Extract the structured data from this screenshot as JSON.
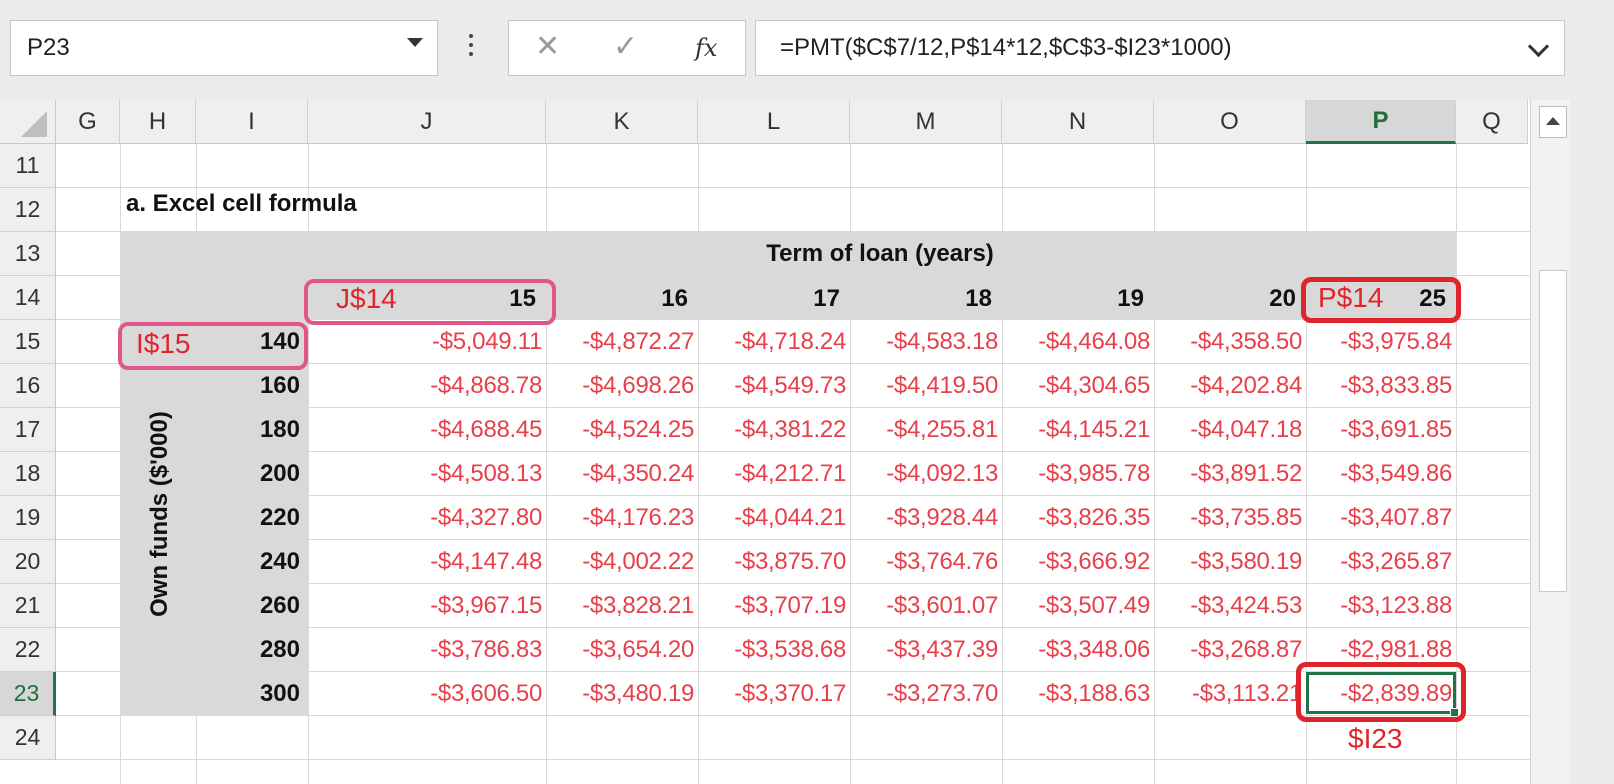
{
  "toolbar": {
    "name_box": "P23",
    "cancel_glyph": "✕",
    "enter_glyph": "✓",
    "fx_label": "fx",
    "formula": "=PMT($C$7/12,P$14*12,$C$3-$I23*1000)"
  },
  "columns": [
    "G",
    "H",
    "I",
    "J",
    "K",
    "L",
    "M",
    "N",
    "O",
    "P",
    "Q"
  ],
  "rows": [
    "11",
    "12",
    "13",
    "14",
    "15",
    "16",
    "17",
    "18",
    "19",
    "20",
    "21",
    "22",
    "23",
    "24"
  ],
  "sheet": {
    "title": "a. Excel cell formula",
    "term_header": "Term of loan (years)",
    "own_funds_label": "Own funds ($'000)",
    "years": [
      "15",
      "16",
      "17",
      "18",
      "19",
      "20",
      "25"
    ],
    "funds": [
      "140",
      "160",
      "180",
      "200",
      "220",
      "240",
      "260",
      "280",
      "300"
    ],
    "values": [
      [
        "-$5,049.11",
        "-$4,872.27",
        "-$4,718.24",
        "-$4,583.18",
        "-$4,464.08",
        "-$4,358.50",
        "-$3,975.84"
      ],
      [
        "-$4,868.78",
        "-$4,698.26",
        "-$4,549.73",
        "-$4,419.50",
        "-$4,304.65",
        "-$4,202.84",
        "-$3,833.85"
      ],
      [
        "-$4,688.45",
        "-$4,524.25",
        "-$4,381.22",
        "-$4,255.81",
        "-$4,145.21",
        "-$4,047.18",
        "-$3,691.85"
      ],
      [
        "-$4,508.13",
        "-$4,350.24",
        "-$4,212.71",
        "-$4,092.13",
        "-$3,985.78",
        "-$3,891.52",
        "-$3,549.86"
      ],
      [
        "-$4,327.80",
        "-$4,176.23",
        "-$4,044.21",
        "-$3,928.44",
        "-$3,826.35",
        "-$3,735.85",
        "-$3,407.87"
      ],
      [
        "-$4,147.48",
        "-$4,002.22",
        "-$3,875.70",
        "-$3,764.76",
        "-$3,666.92",
        "-$3,580.19",
        "-$3,265.87"
      ],
      [
        "-$3,967.15",
        "-$3,828.21",
        "-$3,707.19",
        "-$3,601.07",
        "-$3,507.49",
        "-$3,424.53",
        "-$3,123.88"
      ],
      [
        "-$3,786.83",
        "-$3,654.20",
        "-$3,538.68",
        "-$3,437.39",
        "-$3,348.06",
        "-$3,268.87",
        "-$2,981.88"
      ],
      [
        "-$3,606.50",
        "-$3,480.19",
        "-$3,370.17",
        "-$3,273.70",
        "-$3,188.63",
        "-$3,113.21",
        "-$2,839.89"
      ]
    ]
  },
  "annotations": {
    "j14": "J$14",
    "i15": "I$15",
    "p14": "P$14",
    "i23": "$I23"
  },
  "colors": {
    "accent": "#217346",
    "value_text": "#e8404a",
    "annotation_red": "#e0242b",
    "annotation_pink": "#e0568a"
  }
}
